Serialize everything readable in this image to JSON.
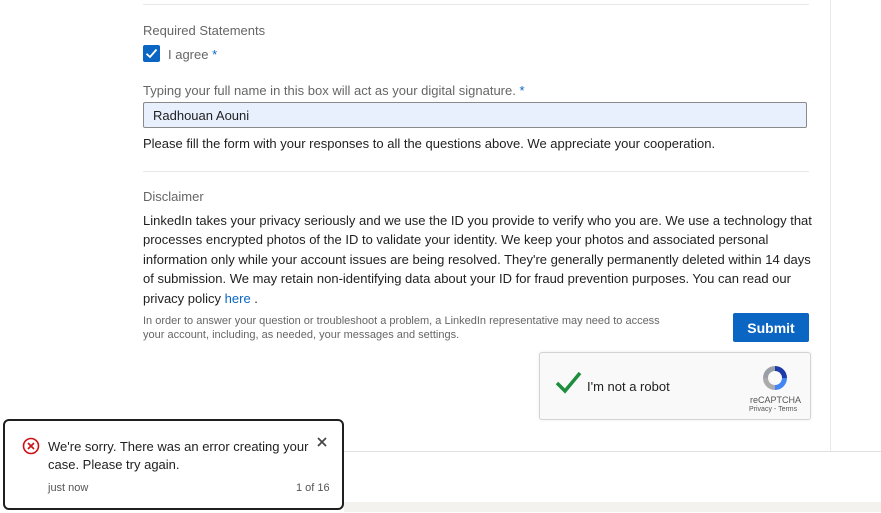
{
  "required_statements": {
    "heading": "Required Statements",
    "agree_label": "I agree",
    "agree_checked": true,
    "required_marker": "*"
  },
  "signature": {
    "label": "Typing your full name in this box will act as your digital signature.",
    "required_marker": "*",
    "value": "Radhouan Aouni",
    "help": "Please fill the form with your responses to all the questions above. We appreciate your cooperation."
  },
  "disclaimer": {
    "heading": "Disclaimer",
    "text": "LinkedIn takes your privacy seriously and we use the ID you provide to verify who you are. We use a technology that processes encrypted photos of the ID to validate your identity. We keep your photos and associated personal information only while your account issues are being resolved. They're generally permanently deleted within 14 days of submission. We may retain non-identifying data about your ID for fraud prevention purposes. You can read our privacy policy",
    "link_label": "here",
    "suffix": " ."
  },
  "fine_print": "In order to answer your question or troubleshoot a problem, a LinkedIn representative may need to access your account, including, as needed, your messages and settings.",
  "submit_label": "Submit",
  "captcha": {
    "label": "I'm not a robot",
    "brand": "reCAPTCHA",
    "privacy": "Privacy",
    "separator": "-",
    "terms": "Terms"
  },
  "toast": {
    "message": "We're sorry. There was an error creating your case. Please try again.",
    "time": "just now",
    "counter": "1 of 16"
  },
  "colors": {
    "accent": "#0a66c2",
    "error": "#cc1016",
    "captcha_check": "#1e8e3e"
  }
}
